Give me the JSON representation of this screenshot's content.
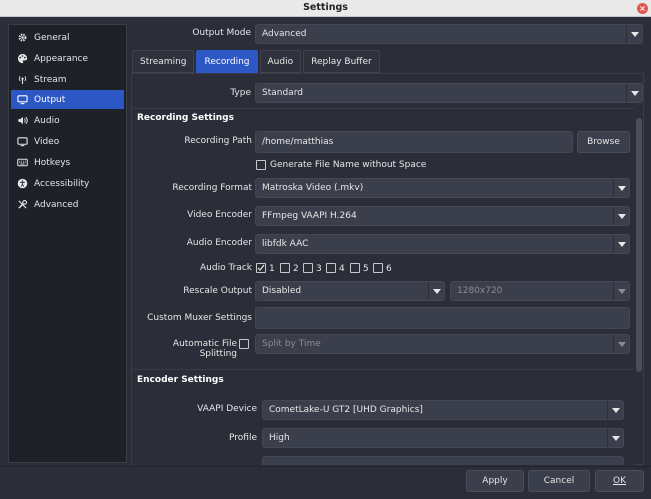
{
  "window": {
    "title": "Settings"
  },
  "sidebar": {
    "items": [
      {
        "label": "General",
        "icon": "gear-icon"
      },
      {
        "label": "Appearance",
        "icon": "palette-icon"
      },
      {
        "label": "Stream",
        "icon": "antenna-icon"
      },
      {
        "label": "Output",
        "icon": "monitor-icon"
      },
      {
        "label": "Audio",
        "icon": "speaker-icon"
      },
      {
        "label": "Video",
        "icon": "video-icon"
      },
      {
        "label": "Hotkeys",
        "icon": "keyboard-icon"
      },
      {
        "label": "Accessibility",
        "icon": "accessibility-icon"
      },
      {
        "label": "Advanced",
        "icon": "tools-icon"
      }
    ],
    "active": "Output"
  },
  "output_mode": {
    "label": "Output Mode",
    "value": "Advanced"
  },
  "tabs": [
    {
      "label": "Streaming"
    },
    {
      "label": "Recording"
    },
    {
      "label": "Audio"
    },
    {
      "label": "Replay Buffer"
    }
  ],
  "type": {
    "label": "Type",
    "value": "Standard"
  },
  "recording_settings": {
    "heading": "Recording Settings",
    "path_label": "Recording Path",
    "path_value": "/home/matthias",
    "browse_label": "Browse",
    "gen_filename_label": "Generate File Name without Space",
    "format_label": "Recording Format",
    "format_value": "Matroska Video (.mkv)",
    "video_encoder_label": "Video Encoder",
    "video_encoder_value": "FFmpeg VAAPI H.264",
    "audio_encoder_label": "Audio Encoder",
    "audio_encoder_value": "libfdk AAC",
    "audio_track_label": "Audio Track",
    "tracks": [
      "1",
      "2",
      "3",
      "4",
      "5",
      "6"
    ],
    "rescale_label": "Rescale Output",
    "rescale_value": "Disabled",
    "rescale_res": "1280x720",
    "muxer_label": "Custom Muxer Settings",
    "muxer_value": "",
    "split_label": "Automatic File Splitting",
    "split_value": "Split by Time"
  },
  "encoder_settings": {
    "heading": "Encoder Settings",
    "device_label": "VAAPI Device",
    "device_value": "CometLake-U GT2 [UHD Graphics]",
    "profile_label": "Profile",
    "profile_value": "High"
  },
  "footer": {
    "apply": "Apply",
    "cancel": "Cancel",
    "ok": "OK"
  },
  "colors": {
    "accent": "#2e57c6",
    "background": "#2b2e38",
    "field": "#3b3f4b"
  }
}
